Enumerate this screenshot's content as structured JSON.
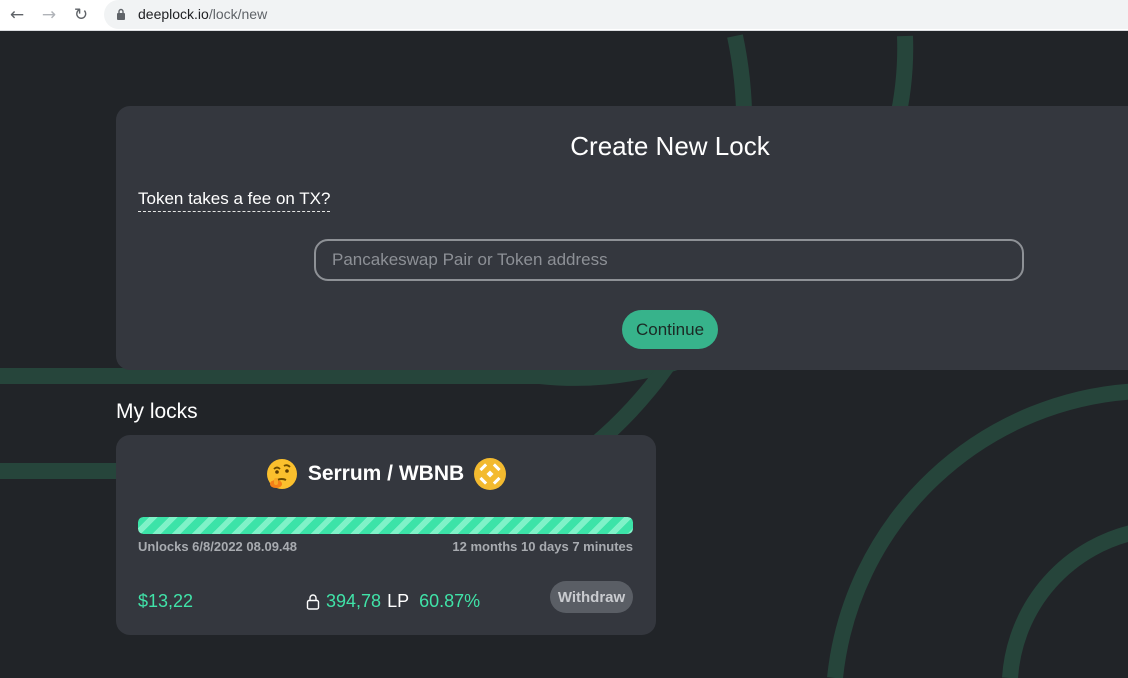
{
  "browser": {
    "url_domain": "deeplock.io",
    "url_path": "/lock/new"
  },
  "create_lock": {
    "title": "Create New Lock",
    "fee_question": "Token takes a fee on TX?",
    "address_placeholder": "Pancakeswap Pair or Token address",
    "continue_label": "Continue"
  },
  "my_locks": {
    "heading": "My locks",
    "items": [
      {
        "pair": "Serrum / WBNB",
        "unlock_date": "Unlocks 6/8/2022 08.09.48",
        "remaining": "12 months 10 days 7 minutes",
        "progress_percent": 100,
        "usd_value": "$13,22",
        "lp_amount": "394,78",
        "lp_unit": "LP",
        "lp_percent": "60.87%",
        "withdraw_label": "Withdraw"
      }
    ]
  },
  "colors": {
    "accent": "#37b38b",
    "value_green": "#40e3a8",
    "background": "#212428",
    "card": "#34373e"
  }
}
